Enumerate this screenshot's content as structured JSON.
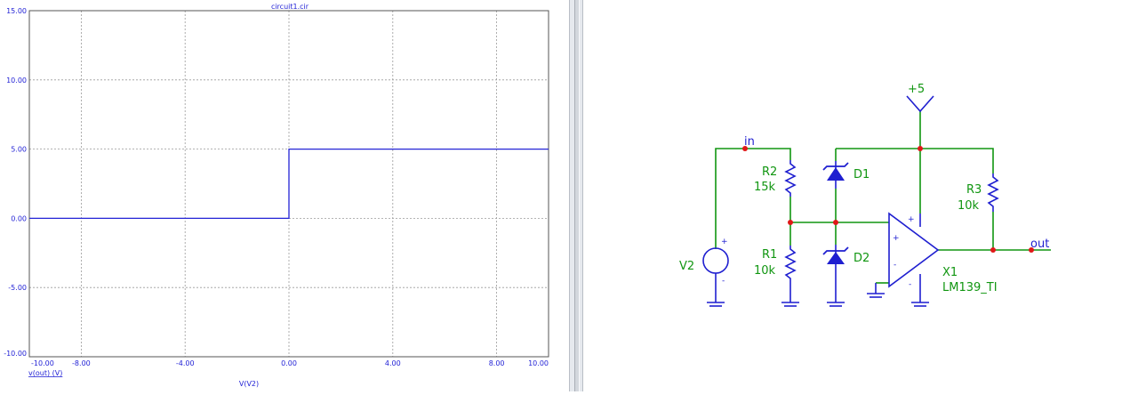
{
  "plot": {
    "title": "circuit1.cir",
    "trace_label": "v(out) (V)",
    "x_axis_label": "V(V2)",
    "trace_color": "#2323d6",
    "grid_color": "#9a9a9a",
    "text_color": "#2323d6"
  },
  "chart_data": {
    "type": "line",
    "title": "circuit1.cir",
    "xlabel": "V(V2)",
    "ylabel": "",
    "xlim": [
      -10,
      10
    ],
    "ylim": [
      -10,
      15
    ],
    "x_ticks": [
      -10,
      -8,
      -4,
      0,
      4,
      8,
      10
    ],
    "x_tick_labels": [
      "-10.00",
      "-8.00",
      "-4.00",
      "0.00",
      "4.00",
      "8.00",
      "10.00"
    ],
    "y_ticks": [
      -10,
      -5,
      0,
      5,
      10,
      15
    ],
    "y_tick_labels": [
      "-10.00",
      "-5.00",
      "0.00",
      "5.00",
      "10.00",
      "15.00"
    ],
    "grid": true,
    "series": [
      {
        "name": "v(out) (V)",
        "x": [
          -10,
          0,
          0,
          10
        ],
        "y": [
          0,
          0,
          5,
          5
        ]
      }
    ]
  },
  "schematic": {
    "supply_label": "+5",
    "net_in_label": "in",
    "net_out_label": "out",
    "r2": {
      "ref": "R2",
      "value": "15k"
    },
    "r1": {
      "ref": "R1",
      "value": "10k"
    },
    "r3": {
      "ref": "R3",
      "value": "10k"
    },
    "d1": {
      "ref": "D1"
    },
    "d2": {
      "ref": "D2"
    },
    "v2": {
      "ref": "V2"
    },
    "x1": {
      "ref": "X1",
      "value": "LM139_TI"
    },
    "plus_sign": "+",
    "minus_sign": "-",
    "wire_color": "#119611",
    "component_color": "#1f1fd0",
    "junction_color": "#e01818"
  }
}
